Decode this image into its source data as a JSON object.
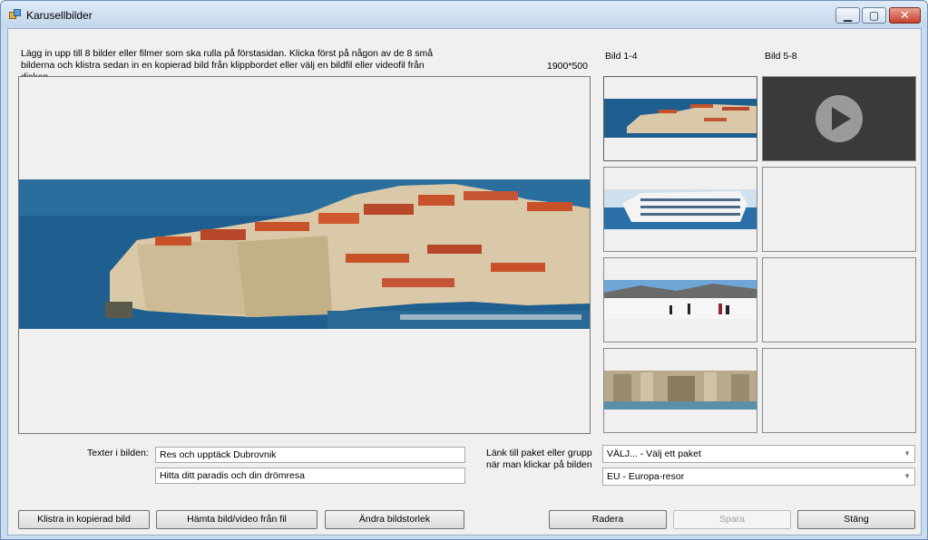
{
  "window": {
    "title": "Karusellbilder"
  },
  "instructions": "Lägg in upp till 8 bilder eller filmer som ska rulla på förstasidan. Klicka först på någon av de 8 små bilderna och klistra sedan in en kopierad bild från klippbordet eller välj en bildfil eller videofil från disken.",
  "image_size": "1900*500",
  "column_headers": {
    "left": "Bild 1-4",
    "right": "Bild 5-8"
  },
  "preview": {
    "content": "dubrovnik-panorama"
  },
  "thumbnails": [
    {
      "slot": 1,
      "content": "dubrovnik-image",
      "selected": true
    },
    {
      "slot": 2,
      "content": "cruise-ship-image"
    },
    {
      "slot": 3,
      "content": "ski-slope-image"
    },
    {
      "slot": 4,
      "content": "trevi-fountain-image"
    },
    {
      "slot": 5,
      "content": "video-play-icon"
    },
    {
      "slot": 6,
      "content": "empty"
    },
    {
      "slot": 7,
      "content": "empty"
    },
    {
      "slot": 8,
      "content": "empty"
    }
  ],
  "texts": {
    "label": "Texter i bilden:",
    "line1": "Res och upptäck Dubrovnik",
    "line2": "Hitta ditt paradis och din drömresa"
  },
  "link": {
    "label_line1": "Länk till paket eller grupp",
    "label_line2": "när man klickar på bilden",
    "package_select": "VÄLJ... - Välj ett paket",
    "group_select": "EU - Europa-resor"
  },
  "buttons": {
    "paste": "Klistra in kopierad bild",
    "load": "Hämta bild/video från fil",
    "resize": "Ändra bildstorlek",
    "delete": "Radera",
    "save": "Spara",
    "close": "Stäng"
  },
  "colors": {
    "sea": "#1f5f8f",
    "roof": "#c8512a",
    "wall": "#d9c9a8",
    "video_bg": "#3a3a3a"
  }
}
